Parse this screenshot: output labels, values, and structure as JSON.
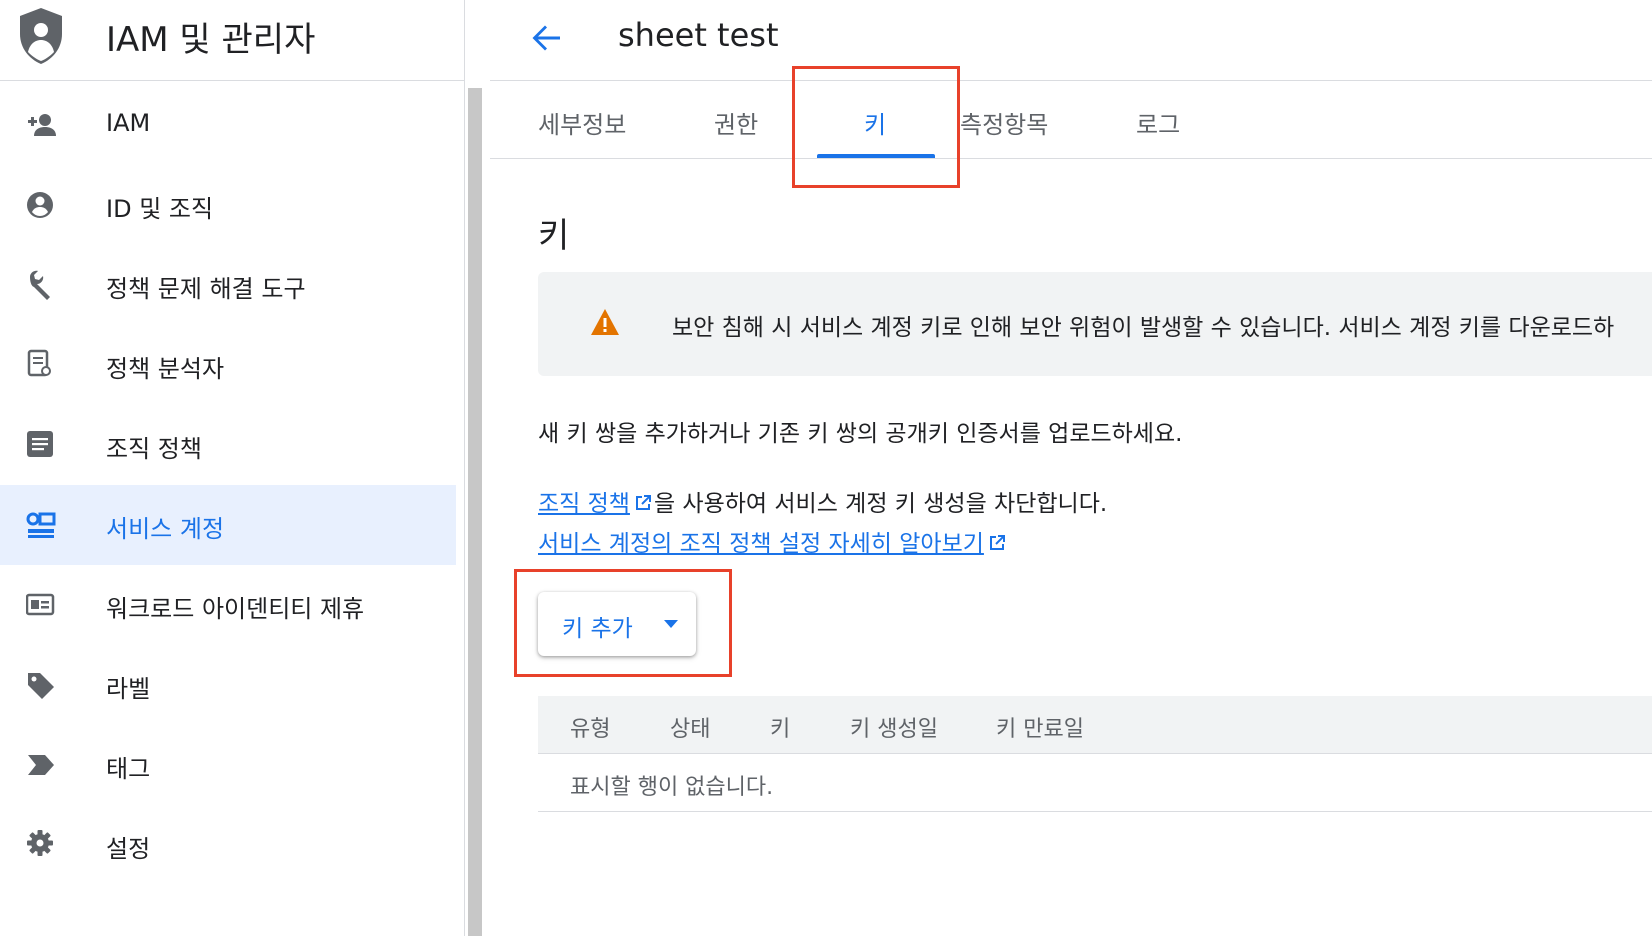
{
  "app": {
    "title": "IAM 및 관리자"
  },
  "sidebar": {
    "items": [
      {
        "label": "IAM",
        "icon": "person-add-icon"
      },
      {
        "label": "ID 및 조직",
        "icon": "account-circle-icon"
      },
      {
        "label": "정책 문제 해결 도구",
        "icon": "wrench-icon"
      },
      {
        "label": "정책 분석자",
        "icon": "policy-analyzer-icon"
      },
      {
        "label": "조직 정책",
        "icon": "document-icon"
      },
      {
        "label": "서비스 계정",
        "icon": "service-account-icon",
        "active": true
      },
      {
        "label": "워크로드 아이덴티티 제휴",
        "icon": "id-card-icon"
      },
      {
        "label": "라벨",
        "icon": "label-tag-icon"
      },
      {
        "label": "태그",
        "icon": "tag-arrow-icon"
      },
      {
        "label": "설정",
        "icon": "gear-icon"
      }
    ]
  },
  "header": {
    "title": "sheet test"
  },
  "tabs": [
    {
      "label": "세부정보"
    },
    {
      "label": "권한"
    },
    {
      "label": "키",
      "active": true
    },
    {
      "label": "측정항목"
    },
    {
      "label": "로그"
    }
  ],
  "main": {
    "section_title": "키",
    "warning_text": "보안 침해 시 서비스 계정 키로 인해 보안 위험이 발생할 수 있습니다. 서비스 계정 키를 다운로드하",
    "description": "새 키 쌍을 추가하거나 기존 키 쌍의 공개키 인증서를 업로드하세요.",
    "policy_link": "조직 정책",
    "policy_suffix": "을 사용하여 서비스 계정 키 생성을 차단합니다.",
    "learn_more_link": "서비스 계정의 조직 정책 설정 자세히 알아보기",
    "add_key_label": "키 추가"
  },
  "table": {
    "headers": [
      "유형",
      "상태",
      "키",
      "키 생성일",
      "키 만료일"
    ],
    "empty_message": "표시할 행이 없습니다."
  },
  "colors": {
    "accent": "#1a73e8",
    "highlight": "#e8412a",
    "warning": "#e37400"
  }
}
